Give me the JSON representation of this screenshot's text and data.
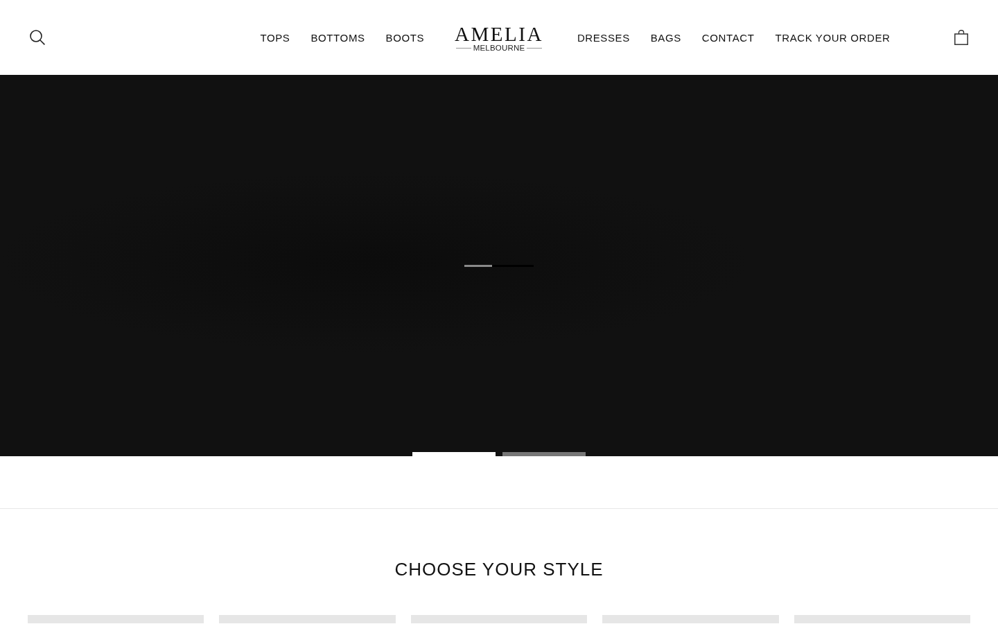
{
  "header": {
    "nav_left": [
      {
        "label": "TOPS"
      },
      {
        "label": "BOTTOMS"
      },
      {
        "label": "BOOTS"
      }
    ],
    "logo": {
      "name": "AMELIA",
      "tagline": "MELBOURNE"
    },
    "nav_right": [
      {
        "label": "DRESSES"
      },
      {
        "label": "BAGS"
      },
      {
        "label": "CONTACT"
      },
      {
        "label": "TRACK YOUR ORDER"
      }
    ]
  },
  "hero": {
    "loader": {
      "level": 0.4
    },
    "slides": [
      {
        "selected": true
      },
      {
        "selected": false
      }
    ]
  },
  "collections": {
    "title": "CHOOSE YOUR STYLE",
    "cards": [
      {
        "kind": "photo"
      },
      {
        "kind": "photo"
      },
      {
        "kind": "photo"
      },
      {
        "kind": "photo"
      },
      {
        "kind": "photo"
      }
    ]
  }
}
